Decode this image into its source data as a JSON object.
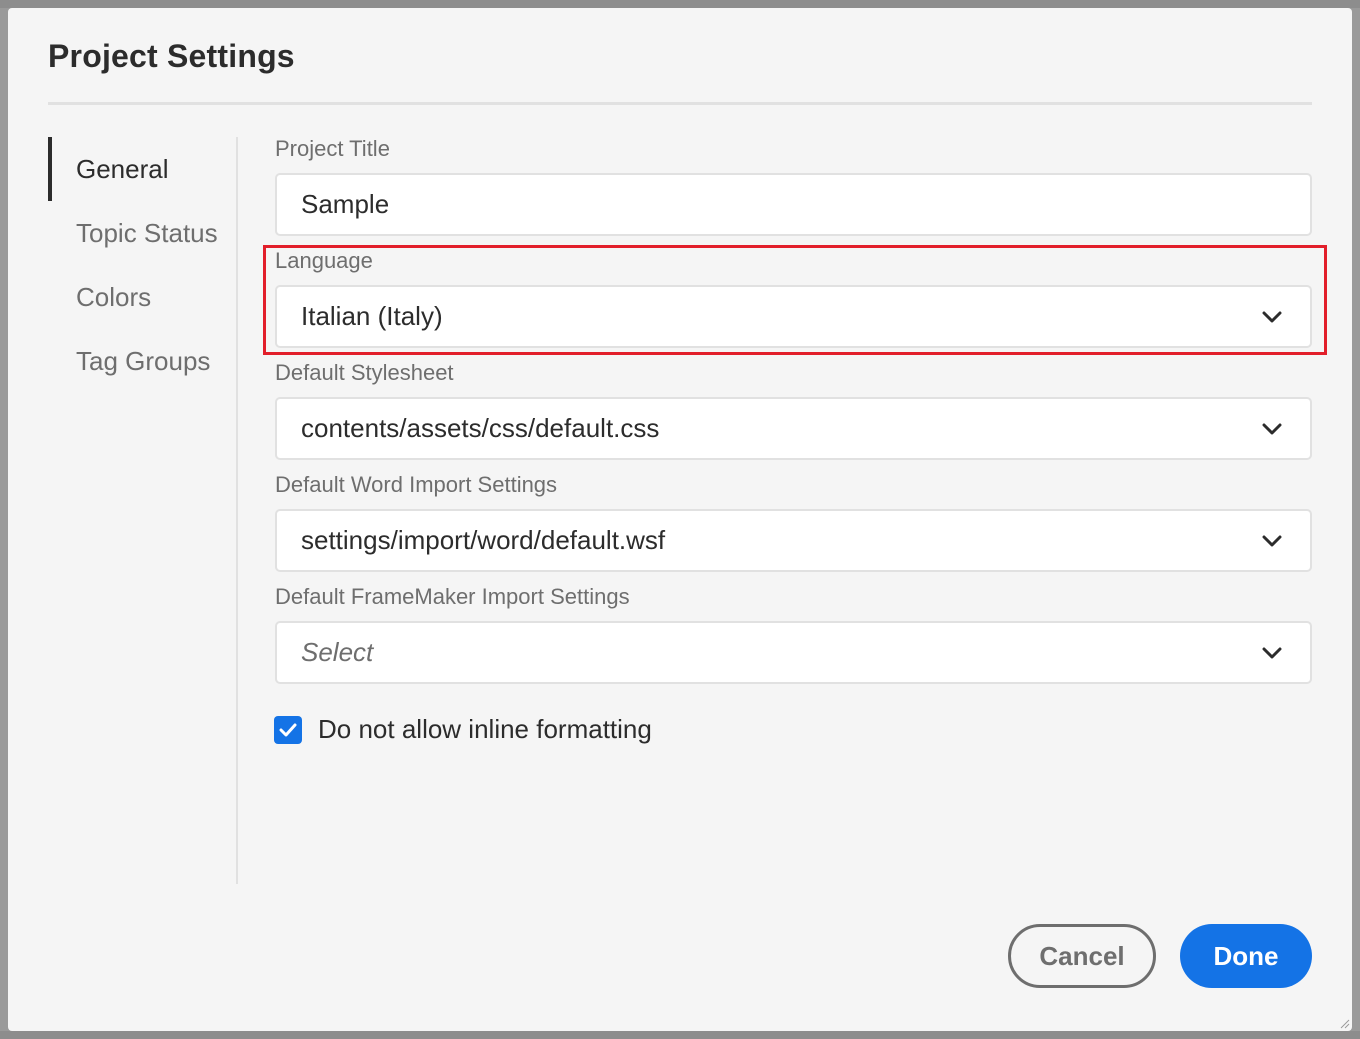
{
  "dialog": {
    "title": "Project Settings"
  },
  "sidebar": {
    "items": [
      {
        "label": "General",
        "active": true
      },
      {
        "label": "Topic Status",
        "active": false
      },
      {
        "label": "Colors",
        "active": false
      },
      {
        "label": "Tag Groups",
        "active": false
      }
    ]
  },
  "form": {
    "project_title": {
      "label": "Project Title",
      "value": "Sample"
    },
    "language": {
      "label": "Language",
      "value": "Italian (Italy)",
      "icon": "chevron-down-icon"
    },
    "default_stylesheet": {
      "label": "Default Stylesheet",
      "value": "contents/assets/css/default.css",
      "icon": "chevron-down-icon"
    },
    "word_import": {
      "label": "Default Word Import Settings",
      "value": "settings/import/word/default.wsf",
      "icon": "chevron-down-icon"
    },
    "framemaker_import": {
      "label": "Default FrameMaker Import Settings",
      "placeholder": "Select",
      "icon": "chevron-down-icon"
    },
    "inline_formatting": {
      "label": "Do not allow inline formatting",
      "checked": true,
      "icon": "checkmark-icon"
    }
  },
  "buttons": {
    "cancel_label": "Cancel",
    "done_label": "Done"
  },
  "colors": {
    "accent": "#1473e6",
    "highlight": "#e21f2a",
    "text_primary": "#2c2c2c",
    "text_secondary": "#6e6e6e"
  }
}
